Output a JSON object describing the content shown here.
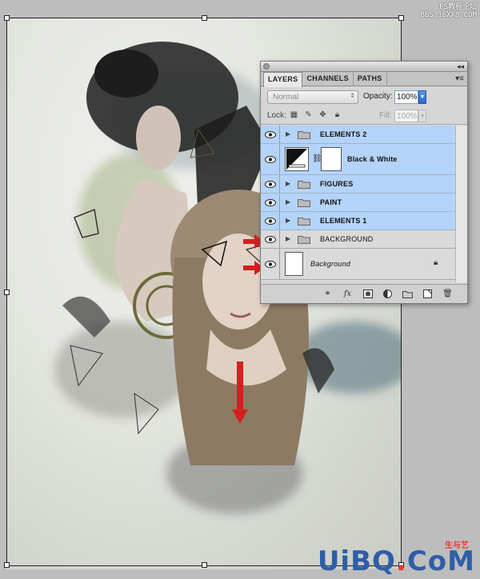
{
  "watermark": {
    "line1": "PS教程论坛",
    "line2": "BBS.16XX8.COM",
    "bottom_main": "UiBQ",
    "bottom_dot": ".",
    "bottom_end": "CoM",
    "bottom_tag": "生与艺"
  },
  "panel": {
    "tabs": [
      "LAYERS",
      "CHANNELS",
      "PATHS"
    ],
    "active_tab": "LAYERS",
    "blend_mode": "Normal",
    "opacity_label": "Opacity:",
    "opacity_value": "100%",
    "lock_label": "Lock:",
    "fill_label": "Fill:",
    "fill_value": "100%",
    "layers": [
      {
        "name": "ELEMENTS 2",
        "type": "group",
        "selected": true
      },
      {
        "name": "Black & White",
        "type": "adjustment",
        "selected": true
      },
      {
        "name": "FIGURES",
        "type": "group",
        "selected": true
      },
      {
        "name": "PAINT",
        "type": "group",
        "selected": true
      },
      {
        "name": "ELEMENTS 1",
        "type": "group",
        "selected": true
      },
      {
        "name": "BACKGROUND",
        "type": "group",
        "selected": false
      },
      {
        "name": "Background",
        "type": "background",
        "selected": false
      }
    ]
  },
  "colors": {
    "selection": "#b4d3f8",
    "arrow": "#d31f1f",
    "opacity_button": "#2a66c6"
  }
}
